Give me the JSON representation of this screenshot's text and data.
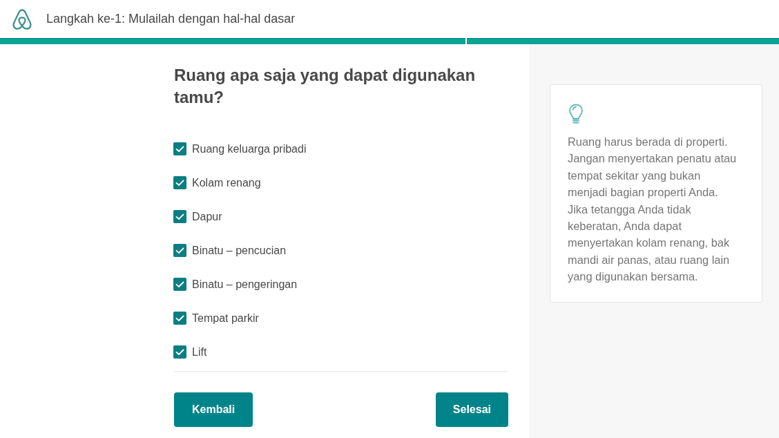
{
  "header": {
    "title": "Langkah ke-1: Mulailah dengan hal-hal dasar"
  },
  "progress": {
    "segments": [
      {
        "completed": true
      },
      {
        "completed": true
      }
    ]
  },
  "question": {
    "title": "Ruang apa saja yang dapat digunakan tamu?"
  },
  "spaces": [
    {
      "label": "Ruang keluarga pribadi",
      "checked": true
    },
    {
      "label": "Kolam renang",
      "checked": true
    },
    {
      "label": "Dapur",
      "checked": true
    },
    {
      "label": "Binatu – pencucian",
      "checked": true
    },
    {
      "label": "Binatu – pengeringan",
      "checked": true
    },
    {
      "label": "Tempat parkir",
      "checked": true
    },
    {
      "label": "Lift",
      "checked": true
    }
  ],
  "buttons": [
    {
      "label": "Kembali"
    },
    {
      "label": "Selesai"
    }
  ],
  "tip": {
    "text": "Ruang harus berada di properti. Jangan menyertakan penatu atau tempat sekitar yang bukan menjadi bagian properti Anda. Jika tetangga Anda tidak keberatan, Anda dapat menyertakan kolam renang, bak mandi air panas, atau ruang lain yang digunakan bersama."
  }
}
